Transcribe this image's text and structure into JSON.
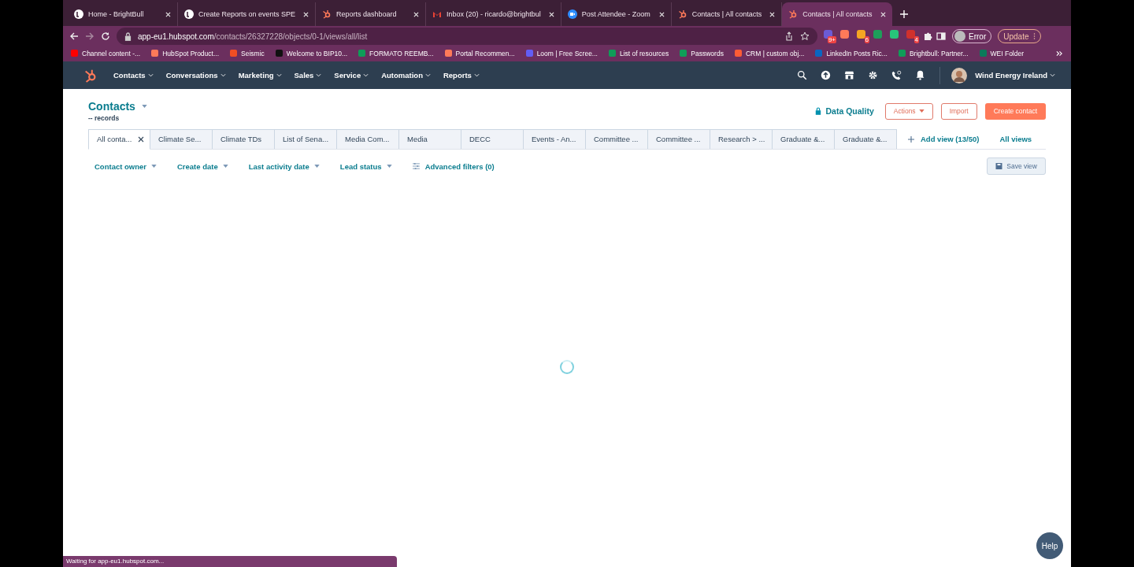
{
  "browser_tabs": [
    {
      "title": "Home - BrightBull",
      "kind": "brightbull",
      "selected": false
    },
    {
      "title": "Create Reports on events SPE",
      "kind": "brightbull",
      "selected": false
    },
    {
      "title": "Reports dashboard",
      "kind": "hubspot",
      "selected": false
    },
    {
      "title": "Inbox (20) - ricardo@brightbul",
      "kind": "gmail",
      "selected": false
    },
    {
      "title": "Post Attendee - Zoom",
      "kind": "zoom",
      "selected": false
    },
    {
      "title": "Contacts | All contacts",
      "kind": "hubspot",
      "selected": false
    },
    {
      "title": "Contacts | All contacts",
      "kind": "hubspot",
      "selected": true
    }
  ],
  "address": {
    "host": "app-eu1.hubspot.com",
    "path": "/contacts/26327228/objects/0-1/views/all/list"
  },
  "extensions": [
    {
      "color": "#6b5bd6",
      "badge": "9+"
    },
    {
      "color": "#ff7a59"
    },
    {
      "color": "#f5a623",
      "badge": "6"
    },
    {
      "color": "#1e9e5a"
    },
    {
      "color": "#27c47a"
    },
    {
      "color": "#d0312d",
      "badge": "4"
    }
  ],
  "profile": {
    "label": "Error"
  },
  "update_button": "Update",
  "bookmarks": [
    {
      "label": "Channel content -...",
      "color": "#ff0000"
    },
    {
      "label": "HubSpot Product...",
      "color": "#ff7a59"
    },
    {
      "label": "Seismic",
      "color": "#f04e23"
    },
    {
      "label": "Welcome to BIP10...",
      "color": "#111111"
    },
    {
      "label": "FORMATO REEMB...",
      "color": "#0f9d58"
    },
    {
      "label": "Portal Recommen...",
      "color": "#ff7a59"
    },
    {
      "label": "Loom | Free Scree...",
      "color": "#625df5"
    },
    {
      "label": "List of resources",
      "color": "#0f9d58"
    },
    {
      "label": "Passwords",
      "color": "#0f9d58"
    },
    {
      "label": "CRM | custom obj...",
      "color": "#ff5c35"
    },
    {
      "label": "LinkedIn Posts Ric...",
      "color": "#0a66c2"
    },
    {
      "label": "Brightbull: Partner...",
      "color": "#0f9d58"
    },
    {
      "label": "WEI Folder",
      "color": "#0b7a5a"
    }
  ],
  "nav": [
    "Contacts",
    "Conversations",
    "Marketing",
    "Sales",
    "Service",
    "Automation",
    "Reports"
  ],
  "account": "Wind Energy Ireland",
  "page": {
    "title": "Contacts",
    "subtitle": "-- records",
    "data_quality": "Data Quality",
    "actions": "Actions",
    "import": "Import",
    "create": "Create contact"
  },
  "views": [
    {
      "label": "All conta...",
      "selected": true
    },
    {
      "label": "Climate Se...",
      "selected": false
    },
    {
      "label": "Climate TDs",
      "selected": false
    },
    {
      "label": "List of Sena...",
      "selected": false
    },
    {
      "label": "Media Com...",
      "selected": false
    },
    {
      "label": "Media",
      "selected": false
    },
    {
      "label": "DECC",
      "selected": false
    },
    {
      "label": "Events - An...",
      "selected": false
    },
    {
      "label": "Committee ...",
      "selected": false
    },
    {
      "label": "Committee ...",
      "selected": false
    },
    {
      "label": "Research > ...",
      "selected": false
    },
    {
      "label": "Graduate &...",
      "selected": false
    },
    {
      "label": "Graduate &...",
      "selected": false
    }
  ],
  "add_view": "Add view (13/50)",
  "all_views": "All views",
  "filters": [
    "Contact owner",
    "Create date",
    "Last activity date",
    "Lead status"
  ],
  "advanced_filters": "Advanced filters (0)",
  "save_view": "Save view",
  "status_bar": "Waiting for app-eu1.hubspot.com...",
  "help": "Help"
}
